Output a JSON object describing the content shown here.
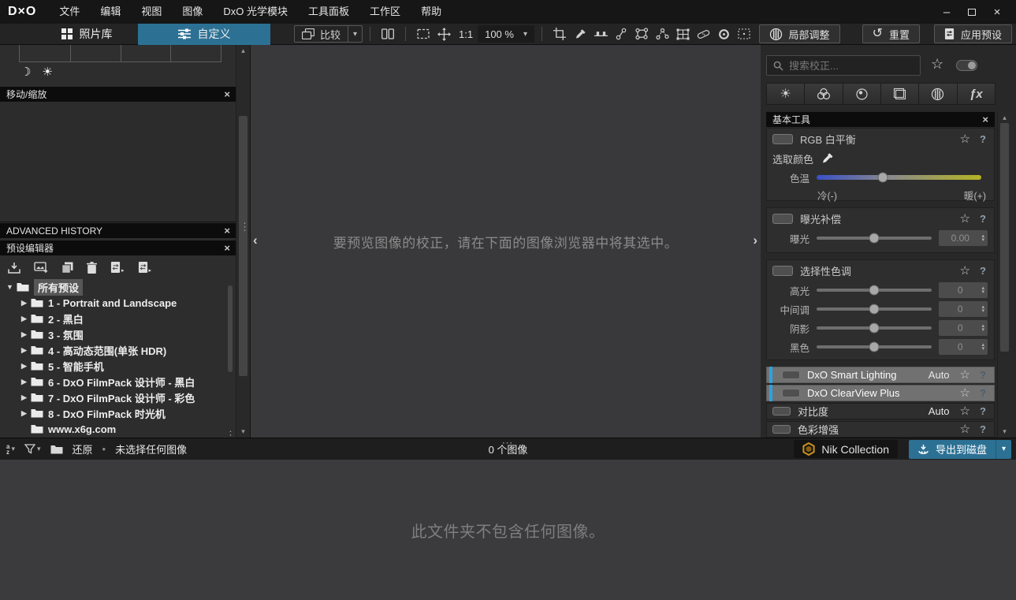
{
  "window": {
    "logo": "D×O",
    "controls": {
      "minimize": "–",
      "close": "×"
    }
  },
  "menubar": {
    "items": [
      "文件",
      "编辑",
      "视图",
      "图像",
      "DxO 光学模块",
      "工具面板",
      "工作区",
      "帮助"
    ]
  },
  "toolbar": {
    "tab_photolibrary": "照片库",
    "tab_customize": "自定义",
    "compare": "比较",
    "ratio": "1:1",
    "zoom": "100 %",
    "local_adjustments": "局部调整",
    "reset": "重置",
    "apply_preset": "应用预设"
  },
  "left_panel": {
    "move_zoom_title": "移动/缩放",
    "history_title": "ADVANCED HISTORY",
    "preset_editor_title": "预设编辑器",
    "tree": [
      {
        "label": "所有预设"
      },
      {
        "label": "1 - Portrait and Landscape"
      },
      {
        "label": "2 - 黑白"
      },
      {
        "label": "3 - 氛围"
      },
      {
        "label": "4 - 高动态范围(单张 HDR)"
      },
      {
        "label": "5 - 智能手机"
      },
      {
        "label": "6 - DxO FilmPack 设计师 - 黑白"
      },
      {
        "label": "7 - DxO FilmPack 设计师 - 彩色"
      },
      {
        "label": "8 - DxO FilmPack 时光机"
      },
      {
        "label": "www.x6g.com"
      }
    ]
  },
  "viewer": {
    "empty_message": "要预览图像的校正，请在下面的图像浏览器中将其选中。"
  },
  "right_panel": {
    "search_placeholder": "搜索校正...",
    "palette_title": "基本工具",
    "white_balance": {
      "title": "RGB 白平衡",
      "pick_color": "选取颜色",
      "temperature": "色温",
      "cold": "冷(-)",
      "warm": "暖(+)"
    },
    "exposure": {
      "title": "曝光补偿",
      "slider_label": "曝光",
      "value": "0.00"
    },
    "selective_tone": {
      "title": "选择性色调",
      "sliders": [
        {
          "label": "高光",
          "value": "0"
        },
        {
          "label": "中间调",
          "value": "0"
        },
        {
          "label": "阴影",
          "value": "0"
        },
        {
          "label": "黑色",
          "value": "0"
        }
      ]
    },
    "corrections": [
      {
        "label": "DxO Smart Lighting",
        "badge": "Auto"
      },
      {
        "label": "DxO ClearView Plus",
        "badge": ""
      },
      {
        "label": "对比度",
        "badge": "Auto"
      },
      {
        "label": "色彩增强",
        "badge": ""
      }
    ]
  },
  "bottom_bar": {
    "restore": "还原",
    "separator": "•",
    "selection_status": "未选择任何图像",
    "image_count": "0 个图像",
    "nik_collection": "Nik Collection",
    "export_to_disk": "导出到磁盘"
  },
  "browser": {
    "empty_message": "此文件夹不包含任何图像。"
  },
  "icons": {
    "close": "×",
    "star": "☆",
    "help": "?",
    "caret_down": "▾",
    "caret_up": "▴",
    "tree_expanded": "▼",
    "tree_collapsed": "▶",
    "flyout": "▸",
    "sun": "☀",
    "moon": "☽",
    "reset": "↺",
    "dots_vertical": "⋮",
    "dots_horizontal": "⋯",
    "chevron_left": "‹",
    "chevron_right": "›",
    "fx": "ƒx",
    "sort_a": "a",
    "sort_z": "z",
    "spin_up": "▴",
    "spin_down": "▾"
  },
  "colors": {
    "accent_blue": "#2c7194",
    "active_row_bg": "#717171",
    "active_row_bar": "#2da2e0"
  }
}
